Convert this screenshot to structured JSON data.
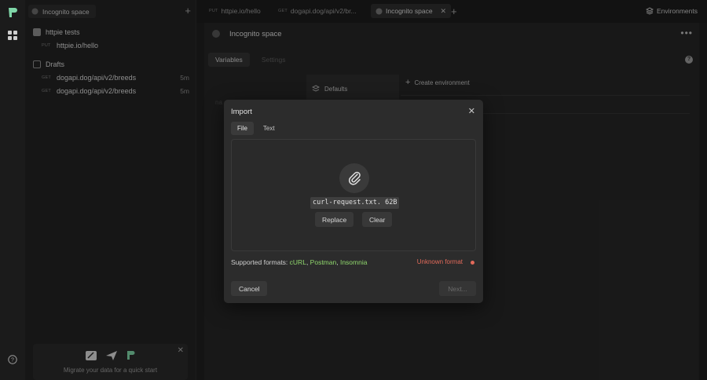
{
  "sidebar": {
    "space_label": "Incognito space",
    "collection": {
      "name": "httpie tests",
      "requests": [
        {
          "method": "PUT",
          "url": "httpie.io/hello"
        }
      ]
    },
    "drafts": {
      "name": "Drafts",
      "requests": [
        {
          "method": "GET",
          "url": "dogapi.dog/api/v2/breeds",
          "age": "5m"
        },
        {
          "method": "GET",
          "url": "dogapi.dog/api/v2/breeds",
          "age": "5m"
        }
      ]
    },
    "migrate_text": "Migrate your data for a quick start"
  },
  "tabs": [
    {
      "method": "PUT",
      "label": "httpie.io/hello"
    },
    {
      "method": "GET",
      "label": "dogapi.dog/api/v2/br..."
    },
    {
      "method": "",
      "label": "Incognito space"
    }
  ],
  "environments_label": "Environments",
  "main": {
    "title": "Incognito space",
    "tabs": [
      "Variables",
      "Settings"
    ],
    "defaults_label": "Defaults",
    "create_env_label": "Create environment",
    "ghost_text": "na"
  },
  "modal": {
    "title": "Import",
    "tabs": [
      "File",
      "Text"
    ],
    "file_label": "curl-request.txt. 62B",
    "replace_label": "Replace",
    "clear_label": "Clear",
    "formats_prefix": "Supported formats:",
    "formats": [
      "cURL",
      "Postman",
      "Insomnia"
    ],
    "status": "Unknown format",
    "cancel_label": "Cancel",
    "next_label": "Next..."
  },
  "colors": {
    "accent_green": "#8fd66c",
    "error_red": "#e26a5a"
  }
}
